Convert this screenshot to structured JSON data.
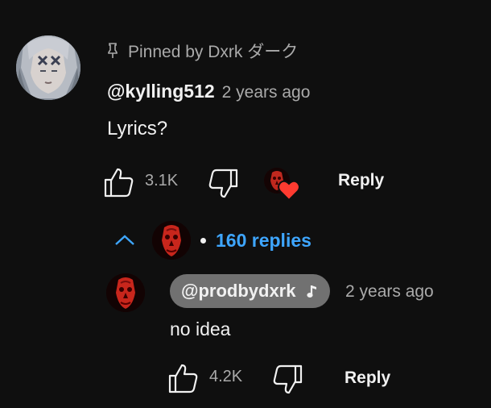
{
  "comment": {
    "pinned_text": "Pinned by Dxrk ダーク",
    "author": "@kylling512",
    "time": "2 years ago",
    "text": "Lyrics?",
    "like_count": "3.1K",
    "reply_label": "Reply"
  },
  "replies_toggle": {
    "label": "160 replies"
  },
  "reply": {
    "author": "@prodbydxrk",
    "time": "2 years ago",
    "text": "no idea",
    "like_count": "4.2K",
    "reply_label": "Reply"
  },
  "colors": {
    "background": "#0f0f0f",
    "primary_text": "#f1f1f1",
    "secondary_text": "#aaaaaa",
    "link_blue": "#3ea6ff",
    "creator_chip": "#717171",
    "heart_red": "#ff3b30"
  },
  "icons": [
    "pin-icon",
    "like-icon",
    "dislike-icon",
    "creator-heart-icon",
    "chevron-up-icon",
    "music-note-icon"
  ]
}
